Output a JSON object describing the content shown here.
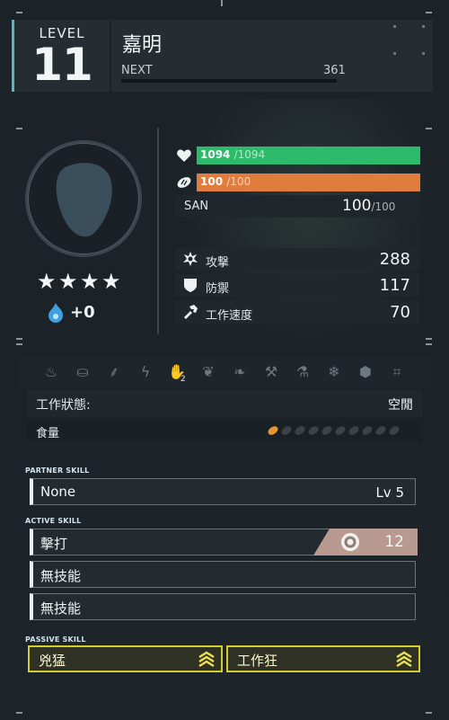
{
  "header": {
    "level_label": "LEVEL",
    "level_value": "11",
    "pal_name": "嘉明",
    "next_label": "NEXT",
    "next_value": "361",
    "next_progress": 0.0
  },
  "profile": {
    "rarity_stars": 4,
    "star_glyph": "★",
    "soul_bonus": "+0"
  },
  "stats": {
    "hp_current": "1094",
    "hp_max": "/1094",
    "hp_color": "#2dba6a",
    "hunger_current": "100",
    "hunger_max": "/100",
    "hunger_color": "#e07d3c",
    "san_label": "SAN",
    "san_current": "100",
    "san_max": "/100",
    "attack_label": "攻撃",
    "attack_value": "288",
    "defense_label": "防禦",
    "defense_value": "117",
    "work_speed_label": "工作速度",
    "work_speed_value": "70"
  },
  "work": {
    "icons": [
      "kindling-icon",
      "watering-icon",
      "planting-icon",
      "electricity-icon",
      "handiwork-icon",
      "gathering-icon",
      "lumbering-icon",
      "mining-icon",
      "medicine-icon",
      "cooling-icon",
      "transporting-icon",
      "farming-icon"
    ],
    "active_icon": "handiwork-icon",
    "handiwork_level": "2",
    "status_label": "工作狀態:",
    "status_value": "空閒",
    "food_label": "食量",
    "food_total": 10,
    "food_filled": 1,
    "food_color": "#e7962e"
  },
  "skills": {
    "partner_label": "PARTNER SKILL",
    "partner_name": "None",
    "partner_level": "Lv 5",
    "active_label": "ACTIVE SKILL",
    "active": [
      {
        "name": "擊打",
        "power": "12",
        "element": "neutral-icon"
      },
      {
        "name": "無技能"
      },
      {
        "name": "無技能"
      }
    ],
    "passive_label": "PASSIVE SKILL",
    "passive": [
      {
        "name": "兇猛",
        "rank_icon": "rank-up-triple-icon"
      },
      {
        "name": "工作狂",
        "rank_icon": "rank-up-triple-icon"
      }
    ],
    "passive_color": "#d5cc2e"
  }
}
